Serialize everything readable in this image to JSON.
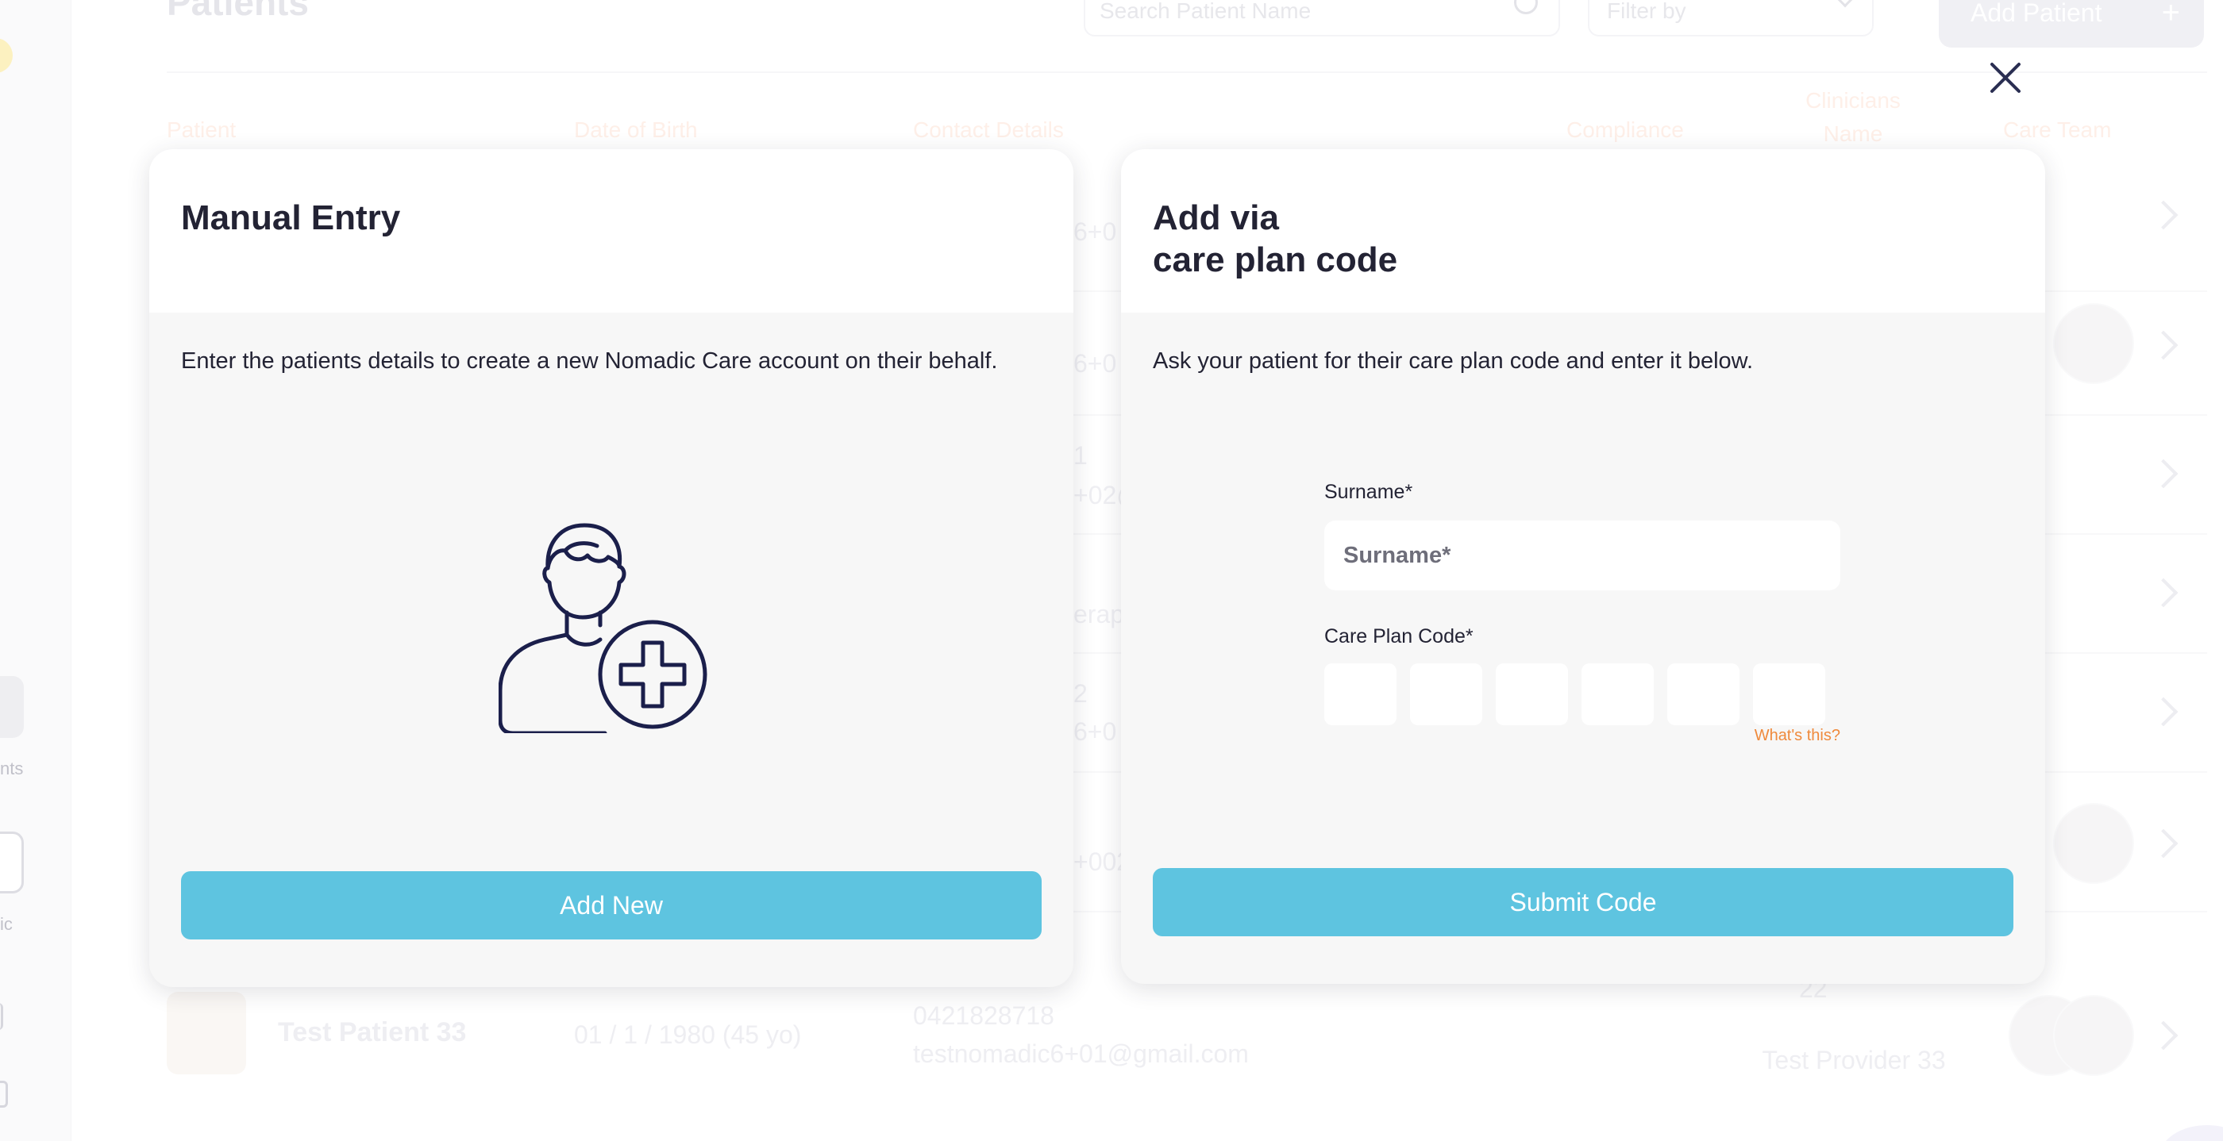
{
  "header": {
    "page_title": "Patients",
    "search_placeholder": "Search Patient Name",
    "filter_label": "Filter by",
    "add_patient_label": "Add Patient",
    "add_patient_icon": "plus-icon"
  },
  "table": {
    "columns": {
      "patient": "Patient",
      "dob": "Date of Birth",
      "contact": "Contact Details",
      "compliance": "Compliance",
      "clinicians_line1": "Clinicians",
      "clinicians_line2": "Name",
      "care_team": "Care Team"
    },
    "peek_fragments": [
      "6+0",
      "6+0",
      "1",
      "+02@",
      "erap",
      "2",
      "6+0",
      "+002"
    ],
    "last_row": {
      "name": "Test Patient 33",
      "dob": "01 / 1 / 1980 (45 yo)",
      "phone": "0421828718",
      "email": "testnomadic6+01@gmail.com",
      "count": "22",
      "provider": "Test Provider 33"
    }
  },
  "sidebar": {
    "items": [
      {
        "label": "nts",
        "icon": "users-icon"
      },
      {
        "label": "ic",
        "icon": "home-icon"
      }
    ]
  },
  "modal": {
    "close_icon": "close-icon",
    "manual_entry": {
      "title": "Manual Entry",
      "description": "Enter the patients details to create a new Nomadic Care account on their behalf.",
      "illustration": "add-user-icon",
      "button_label": "Add New"
    },
    "care_plan": {
      "title_line1": "Add via",
      "title_line2": "care plan code",
      "description": "Ask your patient for their care plan code and enter it below.",
      "surname_label": "Surname*",
      "surname_placeholder": "Surname*",
      "surname_value": "",
      "code_label": "Care Plan Code*",
      "code_digits": [
        "",
        "",
        "",
        "",
        "",
        ""
      ],
      "help_link": "What's this?",
      "button_label": "Submit Code"
    }
  },
  "colors": {
    "accent_button": "#5ec4e0",
    "help_link": "#ef8a3c",
    "text_dark": "#232334",
    "icon_navy": "#1b1f4b"
  }
}
